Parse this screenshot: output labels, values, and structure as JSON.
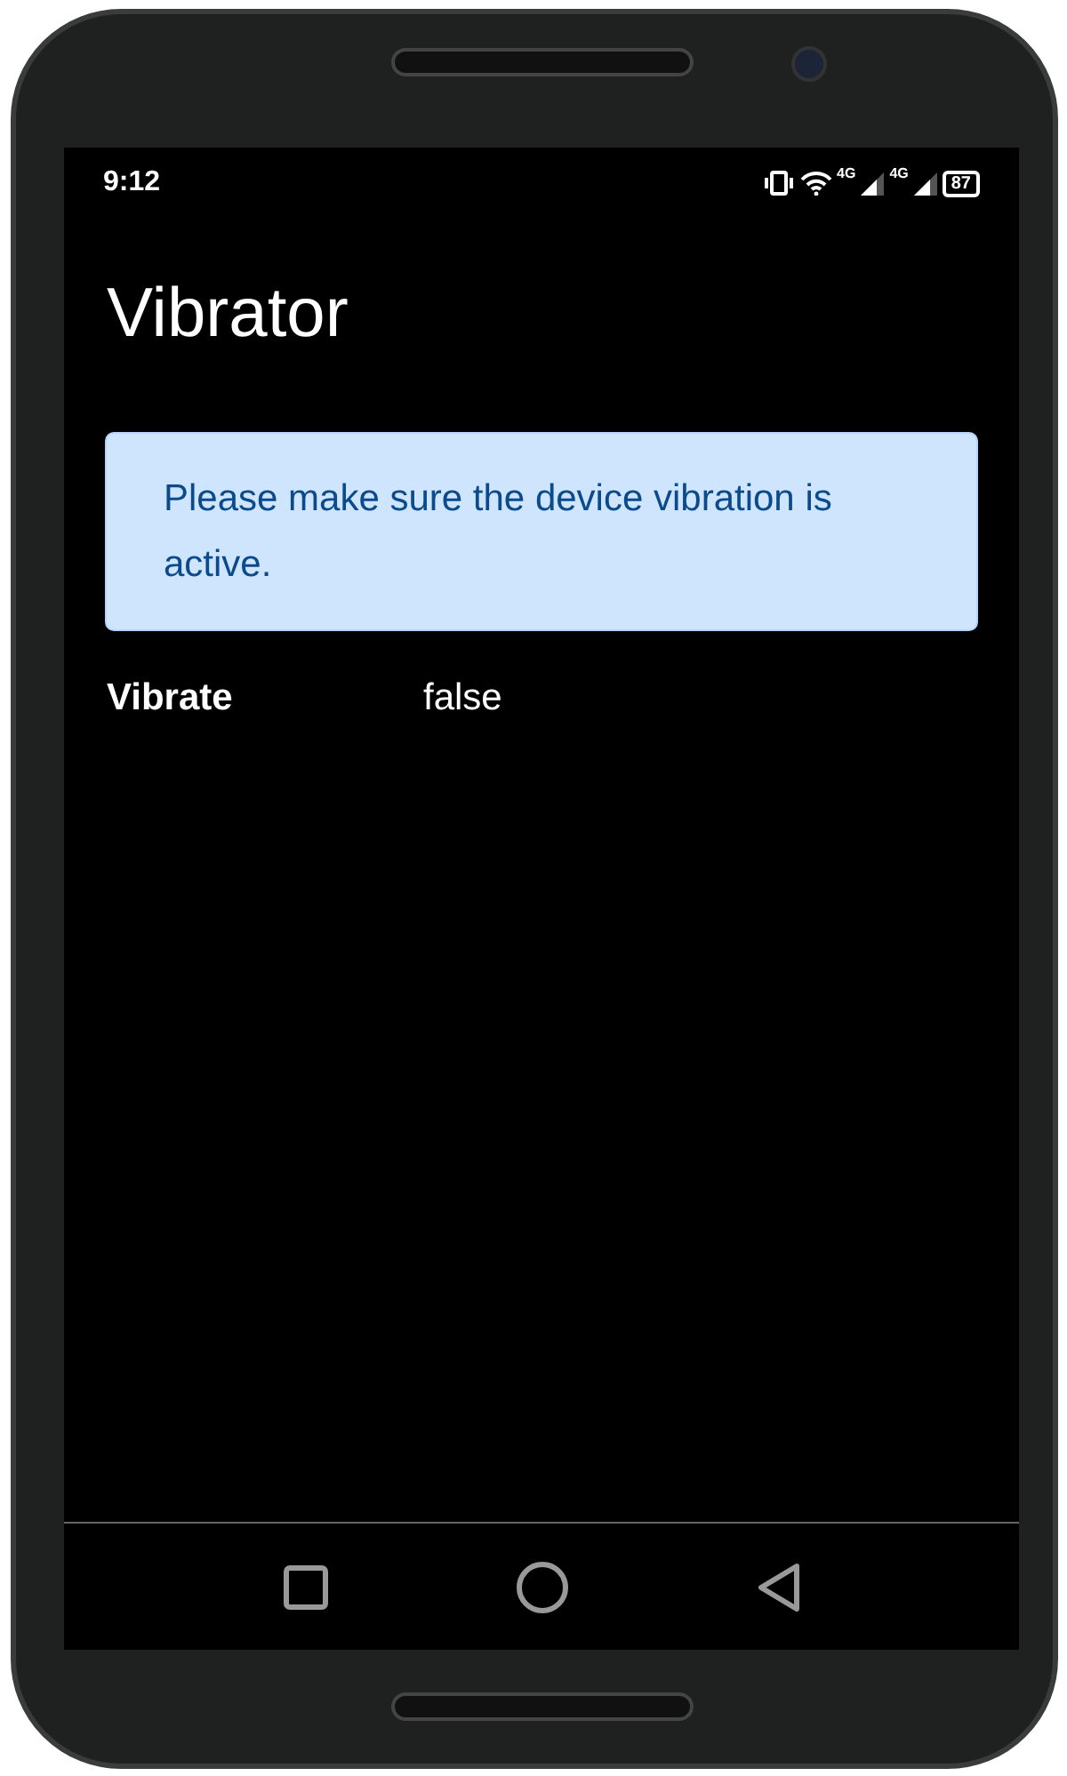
{
  "status_bar": {
    "time": "9:12",
    "network_labels": [
      "4G",
      "4G"
    ],
    "battery": "87"
  },
  "title": "Vibrator",
  "alert": {
    "text": "Please make sure the device vibration is active."
  },
  "fields": [
    {
      "label": "Vibrate",
      "value": "false"
    }
  ]
}
